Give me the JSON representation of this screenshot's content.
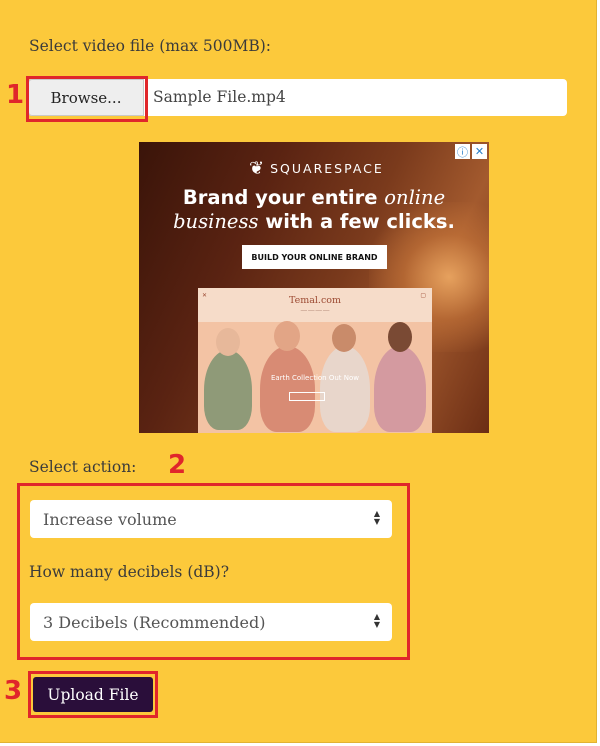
{
  "upload": {
    "file_label": "Select video file (max 500MB):",
    "browse_label": "Browse...",
    "file_name": "Sample File.mp4"
  },
  "ad": {
    "brand": "SQUARESPACE",
    "headline_part1": "Brand your entire ",
    "headline_italic1": "online",
    "headline_italic2": "business",
    "headline_part2": " with a few clicks.",
    "cta": "BUILD YOUR ONLINE BRAND",
    "site_title": "Temal.com",
    "site_hero": "Earth Collection Out Now",
    "info_icon": "info-icon",
    "close_icon": "close-icon"
  },
  "action": {
    "label": "Select action:",
    "selected": "Increase volume"
  },
  "decibels": {
    "label": "How many decibels (dB)?",
    "selected": "3 Decibels (Recommended)"
  },
  "submit": {
    "label": "Upload File"
  },
  "annotations": {
    "step1": "1",
    "step2": "2",
    "step3": "3",
    "color": "#e0262b"
  },
  "colors": {
    "background": "#fcc93b",
    "button_dark": "#2a0e3a"
  }
}
